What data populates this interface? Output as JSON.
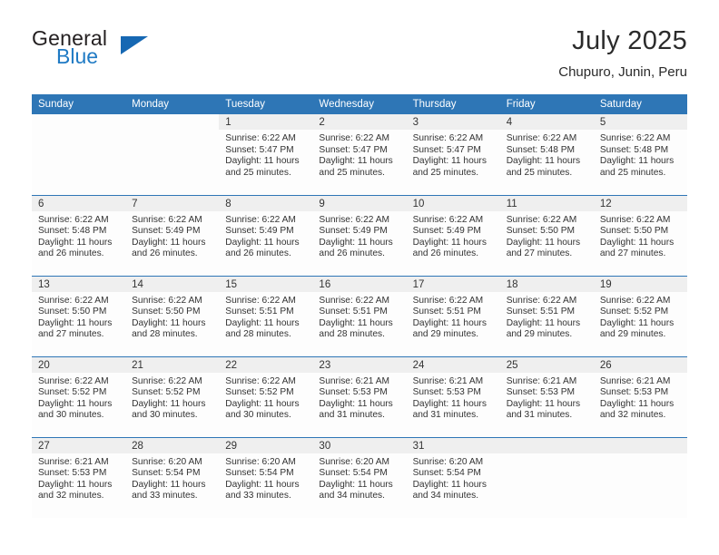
{
  "brand": {
    "line1": "General",
    "line2": "Blue",
    "logo_icon": "blue-triangle-icon",
    "accent_color": "#1668b3"
  },
  "header": {
    "title": "July 2025",
    "subtitle": "Chupuro, Junin, Peru"
  },
  "theme": {
    "header_blue": "#2e76b6",
    "daynum_gray": "#efefef",
    "text": "#333333"
  },
  "calendar": {
    "weekday_headers": [
      "Sunday",
      "Monday",
      "Tuesday",
      "Wednesday",
      "Thursday",
      "Friday",
      "Saturday"
    ],
    "labels": {
      "sunrise": "Sunrise:",
      "sunset": "Sunset:",
      "daylight": "Daylight:"
    },
    "weeks": [
      [
        {
          "day": "",
          "blank": true
        },
        {
          "day": "",
          "blank": true
        },
        {
          "day": "1",
          "sunrise": "Sunrise: 6:22 AM",
          "sunset": "Sunset: 5:47 PM",
          "daylight_line1": "Daylight: 11 hours",
          "daylight_line2": "and 25 minutes."
        },
        {
          "day": "2",
          "sunrise": "Sunrise: 6:22 AM",
          "sunset": "Sunset: 5:47 PM",
          "daylight_line1": "Daylight: 11 hours",
          "daylight_line2": "and 25 minutes."
        },
        {
          "day": "3",
          "sunrise": "Sunrise: 6:22 AM",
          "sunset": "Sunset: 5:47 PM",
          "daylight_line1": "Daylight: 11 hours",
          "daylight_line2": "and 25 minutes."
        },
        {
          "day": "4",
          "sunrise": "Sunrise: 6:22 AM",
          "sunset": "Sunset: 5:48 PM",
          "daylight_line1": "Daylight: 11 hours",
          "daylight_line2": "and 25 minutes."
        },
        {
          "day": "5",
          "sunrise": "Sunrise: 6:22 AM",
          "sunset": "Sunset: 5:48 PM",
          "daylight_line1": "Daylight: 11 hours",
          "daylight_line2": "and 25 minutes."
        }
      ],
      [
        {
          "day": "6",
          "sunrise": "Sunrise: 6:22 AM",
          "sunset": "Sunset: 5:48 PM",
          "daylight_line1": "Daylight: 11 hours",
          "daylight_line2": "and 26 minutes."
        },
        {
          "day": "7",
          "sunrise": "Sunrise: 6:22 AM",
          "sunset": "Sunset: 5:49 PM",
          "daylight_line1": "Daylight: 11 hours",
          "daylight_line2": "and 26 minutes."
        },
        {
          "day": "8",
          "sunrise": "Sunrise: 6:22 AM",
          "sunset": "Sunset: 5:49 PM",
          "daylight_line1": "Daylight: 11 hours",
          "daylight_line2": "and 26 minutes."
        },
        {
          "day": "9",
          "sunrise": "Sunrise: 6:22 AM",
          "sunset": "Sunset: 5:49 PM",
          "daylight_line1": "Daylight: 11 hours",
          "daylight_line2": "and 26 minutes."
        },
        {
          "day": "10",
          "sunrise": "Sunrise: 6:22 AM",
          "sunset": "Sunset: 5:49 PM",
          "daylight_line1": "Daylight: 11 hours",
          "daylight_line2": "and 26 minutes."
        },
        {
          "day": "11",
          "sunrise": "Sunrise: 6:22 AM",
          "sunset": "Sunset: 5:50 PM",
          "daylight_line1": "Daylight: 11 hours",
          "daylight_line2": "and 27 minutes."
        },
        {
          "day": "12",
          "sunrise": "Sunrise: 6:22 AM",
          "sunset": "Sunset: 5:50 PM",
          "daylight_line1": "Daylight: 11 hours",
          "daylight_line2": "and 27 minutes."
        }
      ],
      [
        {
          "day": "13",
          "sunrise": "Sunrise: 6:22 AM",
          "sunset": "Sunset: 5:50 PM",
          "daylight_line1": "Daylight: 11 hours",
          "daylight_line2": "and 27 minutes."
        },
        {
          "day": "14",
          "sunrise": "Sunrise: 6:22 AM",
          "sunset": "Sunset: 5:50 PM",
          "daylight_line1": "Daylight: 11 hours",
          "daylight_line2": "and 28 minutes."
        },
        {
          "day": "15",
          "sunrise": "Sunrise: 6:22 AM",
          "sunset": "Sunset: 5:51 PM",
          "daylight_line1": "Daylight: 11 hours",
          "daylight_line2": "and 28 minutes."
        },
        {
          "day": "16",
          "sunrise": "Sunrise: 6:22 AM",
          "sunset": "Sunset: 5:51 PM",
          "daylight_line1": "Daylight: 11 hours",
          "daylight_line2": "and 28 minutes."
        },
        {
          "day": "17",
          "sunrise": "Sunrise: 6:22 AM",
          "sunset": "Sunset: 5:51 PM",
          "daylight_line1": "Daylight: 11 hours",
          "daylight_line2": "and 29 minutes."
        },
        {
          "day": "18",
          "sunrise": "Sunrise: 6:22 AM",
          "sunset": "Sunset: 5:51 PM",
          "daylight_line1": "Daylight: 11 hours",
          "daylight_line2": "and 29 minutes."
        },
        {
          "day": "19",
          "sunrise": "Sunrise: 6:22 AM",
          "sunset": "Sunset: 5:52 PM",
          "daylight_line1": "Daylight: 11 hours",
          "daylight_line2": "and 29 minutes."
        }
      ],
      [
        {
          "day": "20",
          "sunrise": "Sunrise: 6:22 AM",
          "sunset": "Sunset: 5:52 PM",
          "daylight_line1": "Daylight: 11 hours",
          "daylight_line2": "and 30 minutes."
        },
        {
          "day": "21",
          "sunrise": "Sunrise: 6:22 AM",
          "sunset": "Sunset: 5:52 PM",
          "daylight_line1": "Daylight: 11 hours",
          "daylight_line2": "and 30 minutes."
        },
        {
          "day": "22",
          "sunrise": "Sunrise: 6:22 AM",
          "sunset": "Sunset: 5:52 PM",
          "daylight_line1": "Daylight: 11 hours",
          "daylight_line2": "and 30 minutes."
        },
        {
          "day": "23",
          "sunrise": "Sunrise: 6:21 AM",
          "sunset": "Sunset: 5:53 PM",
          "daylight_line1": "Daylight: 11 hours",
          "daylight_line2": "and 31 minutes."
        },
        {
          "day": "24",
          "sunrise": "Sunrise: 6:21 AM",
          "sunset": "Sunset: 5:53 PM",
          "daylight_line1": "Daylight: 11 hours",
          "daylight_line2": "and 31 minutes."
        },
        {
          "day": "25",
          "sunrise": "Sunrise: 6:21 AM",
          "sunset": "Sunset: 5:53 PM",
          "daylight_line1": "Daylight: 11 hours",
          "daylight_line2": "and 31 minutes."
        },
        {
          "day": "26",
          "sunrise": "Sunrise: 6:21 AM",
          "sunset": "Sunset: 5:53 PM",
          "daylight_line1": "Daylight: 11 hours",
          "daylight_line2": "and 32 minutes."
        }
      ],
      [
        {
          "day": "27",
          "sunrise": "Sunrise: 6:21 AM",
          "sunset": "Sunset: 5:53 PM",
          "daylight_line1": "Daylight: 11 hours",
          "daylight_line2": "and 32 minutes."
        },
        {
          "day": "28",
          "sunrise": "Sunrise: 6:20 AM",
          "sunset": "Sunset: 5:54 PM",
          "daylight_line1": "Daylight: 11 hours",
          "daylight_line2": "and 33 minutes."
        },
        {
          "day": "29",
          "sunrise": "Sunrise: 6:20 AM",
          "sunset": "Sunset: 5:54 PM",
          "daylight_line1": "Daylight: 11 hours",
          "daylight_line2": "and 33 minutes."
        },
        {
          "day": "30",
          "sunrise": "Sunrise: 6:20 AM",
          "sunset": "Sunset: 5:54 PM",
          "daylight_line1": "Daylight: 11 hours",
          "daylight_line2": "and 34 minutes."
        },
        {
          "day": "31",
          "sunrise": "Sunrise: 6:20 AM",
          "sunset": "Sunset: 5:54 PM",
          "daylight_line1": "Daylight: 11 hours",
          "daylight_line2": "and 34 minutes."
        },
        {
          "day": "",
          "empty": true
        },
        {
          "day": "",
          "empty": true
        }
      ]
    ]
  }
}
